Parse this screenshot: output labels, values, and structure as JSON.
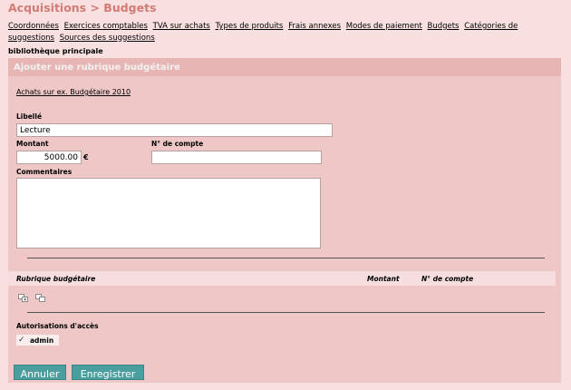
{
  "header": {
    "title": "Acquisitions > Budgets"
  },
  "menu": {
    "items": [
      "Coordonnées",
      "Exercices comptables",
      "TVA sur achats",
      "Types de produits",
      "Frais annexes",
      "Modes de paiement",
      "Budgets",
      "Catégories de suggestions",
      "Sources des suggestions"
    ]
  },
  "library": {
    "label": "bibliothèque principale"
  },
  "panel": {
    "title": "Ajouter une rubrique budgétaire",
    "budget_link": "Achats sur ex. Budgétaire 2010"
  },
  "form": {
    "libelle_label": "Libellé",
    "libelle_value": "Lecture",
    "montant_label": "Montant",
    "montant_value": "5000.00",
    "currency": "€",
    "compte_label": "N° de compte",
    "compte_value": "",
    "comment_label": "Commentaires",
    "comment_value": ""
  },
  "table": {
    "col_rubrique": "Rubrique budgétaire",
    "col_montant": "Montant",
    "col_compte": "N° de compte",
    "icons": [
      "add-row-icon",
      "copy-row-icon"
    ]
  },
  "access": {
    "label": "Autorisations d'accès",
    "user": "admin",
    "checked": true
  },
  "buttons": {
    "cancel": "Annuler",
    "save": "Enregistrer"
  },
  "colors": {
    "title": "#d27b74",
    "panel_bg": "#efc7c7",
    "button_bg": "#4b9e9e"
  }
}
